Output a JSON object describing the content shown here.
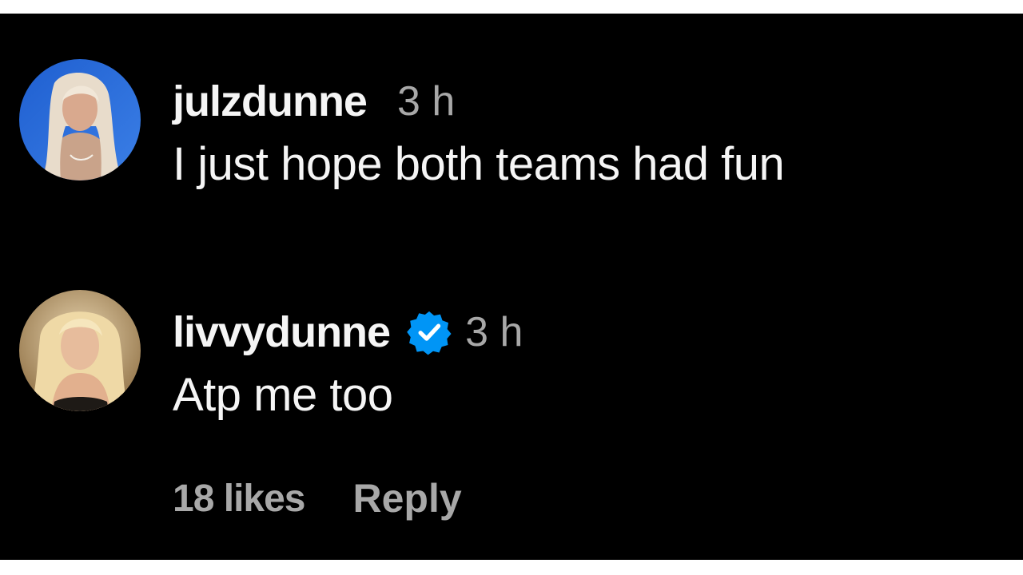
{
  "comments": [
    {
      "username": "julzdunne",
      "time": "3 h",
      "text": "I just hope both teams had fun",
      "verified": false,
      "avatar": "profile-photo"
    },
    {
      "username": "livvydunne",
      "time": "3 h",
      "text": "Atp me too",
      "verified": true,
      "verified_icon": "verified-badge-icon",
      "avatar": "profile-photo",
      "likes": "18 likes",
      "reply_label": "Reply"
    }
  ],
  "colors": {
    "background": "#000000",
    "primary_text": "#f5f5f5",
    "secondary_text": "#a8a8a8",
    "verified_blue": "#0095f6"
  }
}
